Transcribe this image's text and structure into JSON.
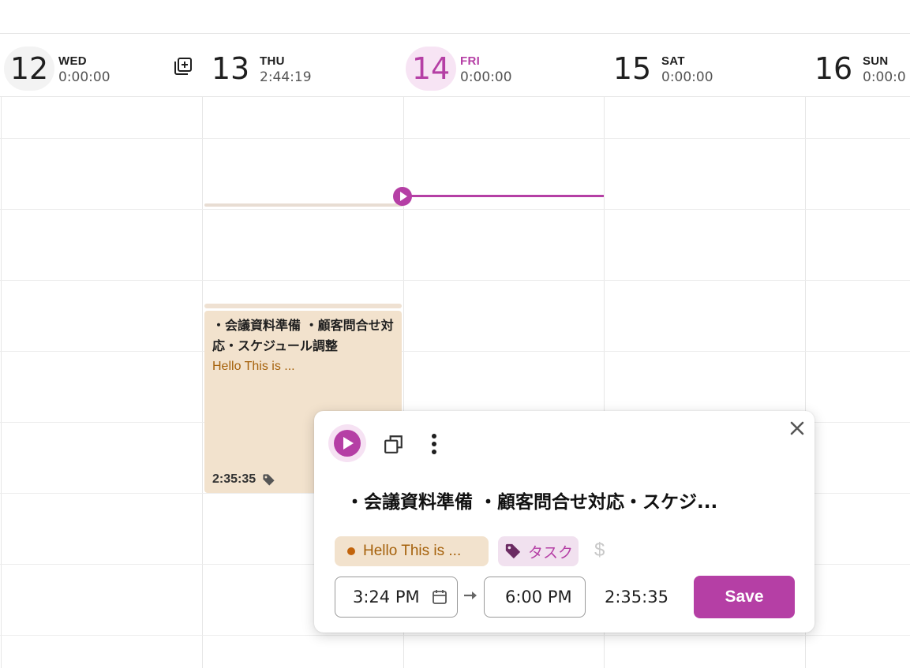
{
  "days": [
    {
      "num": "12",
      "name": "WED",
      "time": "0:00:00"
    },
    {
      "num": "13",
      "name": "THU",
      "time": "2:44:19"
    },
    {
      "num": "14",
      "name": "FRI",
      "time": "0:00:00"
    },
    {
      "num": "15",
      "name": "SAT",
      "time": "0:00:00"
    },
    {
      "num": "16",
      "name": "SUN",
      "time": "0:00:0"
    }
  ],
  "event": {
    "title": "・会議資料準備 ・顧客問合せ対応・スケジュール調整",
    "description": "Hello This is ...",
    "duration": "2:35:35",
    "tag_icon": "tag-icon"
  },
  "popup": {
    "title": "・会議資料準備 ・顧客問合せ対応・スケジ...",
    "project": "Hello This is ...",
    "tag": "タスク",
    "dollar": "$",
    "start_time": "3:24 PM",
    "end_time": "6:00 PM",
    "duration": "2:35:35",
    "save_label": "Save"
  },
  "colors": {
    "accent": "#b53fa5",
    "event_bg": "#f2e2cd",
    "event_text": "#a5610b"
  }
}
